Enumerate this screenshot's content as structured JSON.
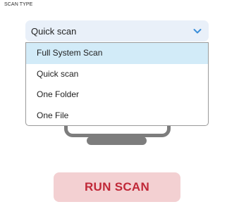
{
  "scan_type": {
    "label": "SCAN TYPE",
    "selected_value": "Quick scan",
    "chevron_icon": "chevron-down-icon",
    "options": [
      {
        "label": "Full System Scan",
        "highlighted": true
      },
      {
        "label": "Quick scan",
        "highlighted": false
      },
      {
        "label": "One Folder",
        "highlighted": false
      },
      {
        "label": "One File",
        "highlighted": false
      }
    ]
  },
  "illustration": {
    "icon": "monitor-icon"
  },
  "actions": {
    "run_label": "RUN SCAN"
  },
  "colors": {
    "select_bg": "#e9f0f9",
    "chevron": "#3b8fd9",
    "option_highlight": "#d2ebf8",
    "button_bg": "#f3d0d2",
    "button_text": "#c02838",
    "monitor": "#7d7d7d"
  }
}
